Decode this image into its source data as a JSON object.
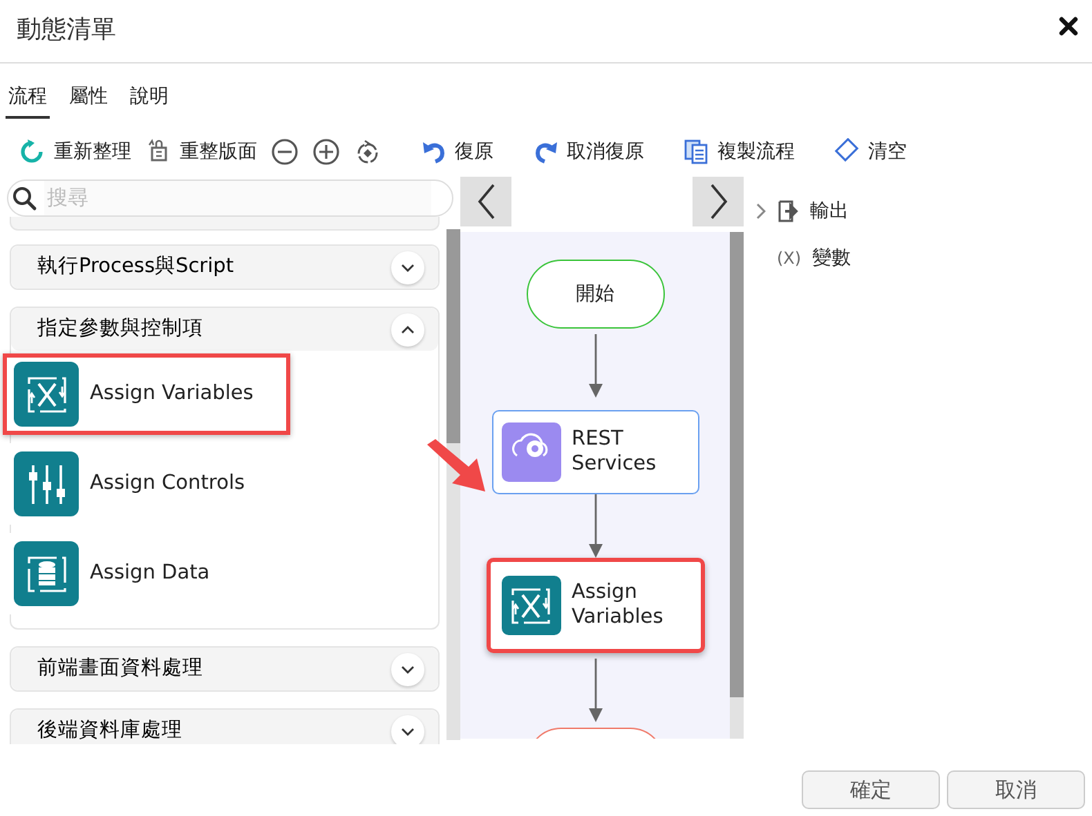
{
  "dialog": {
    "title": "動態清單"
  },
  "tabs": [
    {
      "label": "流程",
      "selected": true
    },
    {
      "label": "屬性",
      "selected": false
    },
    {
      "label": "說明",
      "selected": false
    }
  ],
  "toolbar": [
    {
      "kind": "refresh",
      "label": "重新整理"
    },
    {
      "kind": "relayout",
      "label": "重整版面"
    },
    {
      "kind": "zoom-out"
    },
    {
      "kind": "zoom-in"
    },
    {
      "kind": "fit"
    },
    {
      "kind": "undo",
      "label": "復原"
    },
    {
      "kind": "redo",
      "label": "取消復原"
    },
    {
      "kind": "copy",
      "label": "複製流程"
    },
    {
      "kind": "clear",
      "label": "清空"
    }
  ],
  "search": {
    "placeholder": "搜尋"
  },
  "categories": [
    {
      "label": "執行Process與Script",
      "expanded": false
    },
    {
      "label": "指定參數與控制項",
      "expanded": true,
      "items": [
        {
          "kind": "variables",
          "label": "Assign Variables",
          "highlighted": true
        },
        {
          "kind": "controls",
          "label": "Assign Controls",
          "highlighted": false
        },
        {
          "kind": "data",
          "label": "Assign Data",
          "highlighted": false
        }
      ]
    },
    {
      "label": "前端畫面資料處理",
      "expanded": false
    },
    {
      "label": "後端資料庫處理",
      "expanded": false
    }
  ],
  "flow": {
    "nodes": [
      {
        "kind": "start",
        "label": "開始"
      },
      {
        "kind": "rest",
        "label": "REST Services",
        "highlighted": false
      },
      {
        "kind": "variables",
        "label": "Assign Variables",
        "highlighted": true
      },
      {
        "kind": "end"
      }
    ]
  },
  "side_panel": {
    "items": [
      {
        "kind": "output",
        "label": "輸出"
      },
      {
        "kind": "variable",
        "icon_text": "(X)",
        "label": "變數"
      }
    ]
  },
  "buttons": [
    {
      "label": "確定"
    },
    {
      "label": "取消"
    }
  ]
}
